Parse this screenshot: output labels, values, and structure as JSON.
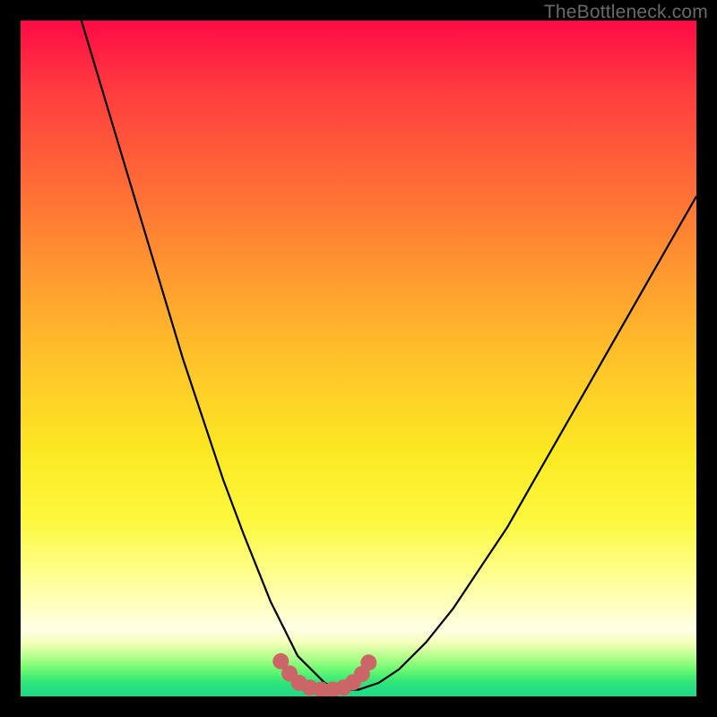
{
  "watermark": "TheBottleneck.com",
  "chart_data": {
    "type": "line",
    "title": "",
    "xlabel": "",
    "ylabel": "",
    "xlim": [
      0,
      100
    ],
    "ylim": [
      0,
      100
    ],
    "series": [
      {
        "name": "bottleneck-curve",
        "x": [
          9,
          12,
          15,
          18,
          21,
          24,
          27,
          30,
          33,
          35,
          37,
          39,
          41,
          43,
          45,
          47,
          50,
          53,
          56,
          60,
          64,
          68,
          72,
          76,
          80,
          84,
          88,
          92,
          96,
          100
        ],
        "values": [
          100,
          90,
          80,
          70,
          60,
          50,
          41,
          32,
          24,
          19,
          14,
          10,
          6,
          4,
          2,
          1,
          1,
          2,
          4,
          8,
          13,
          19,
          25,
          32,
          39,
          46,
          53,
          60,
          67,
          74
        ]
      }
    ],
    "markers": {
      "name": "bottom-dots",
      "x": [
        38.5,
        39.8,
        41.2,
        42.8,
        44.5,
        46.2,
        47.8,
        49.2,
        50.5,
        51.5
      ],
      "values": [
        5.2,
        3.4,
        2.0,
        1.3,
        1.0,
        1.0,
        1.3,
        2.1,
        3.3,
        5.0
      ]
    },
    "colors": {
      "curve": "#000000",
      "markers": "#cc6666"
    }
  }
}
